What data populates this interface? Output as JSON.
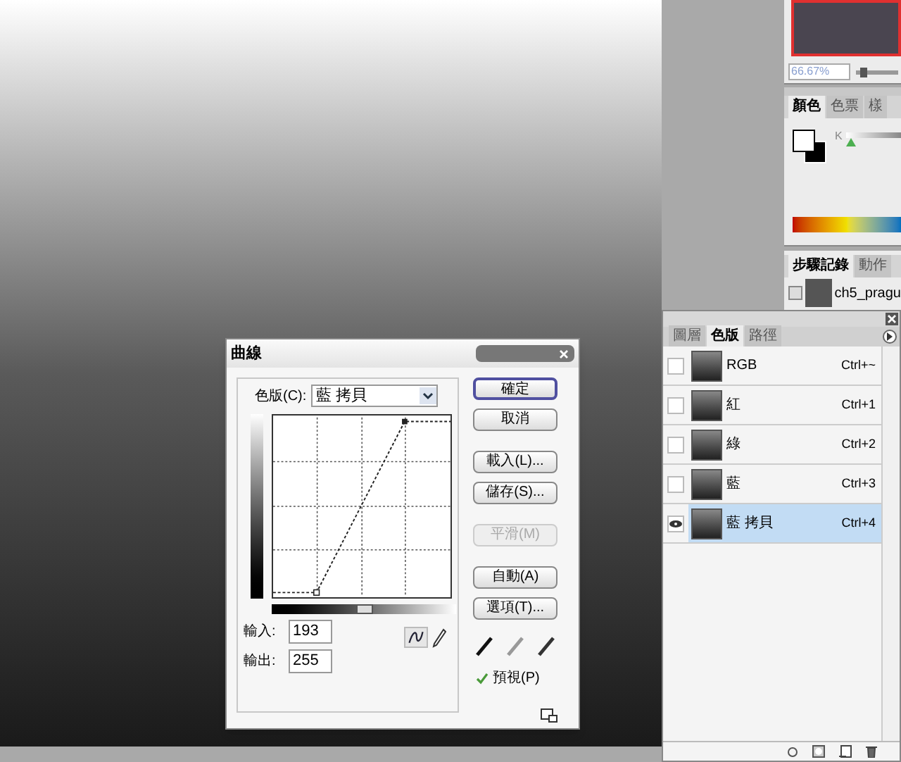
{
  "navigator": {
    "zoom": "66.67%",
    "level": 0.1
  },
  "color_panel": {
    "tabs": [
      {
        "label": "顏色",
        "selected": true
      },
      {
        "label": "色票",
        "selected": false
      },
      {
        "label": "樣",
        "selected": false
      }
    ],
    "slider_label": "K",
    "level": 0
  },
  "history_panel": {
    "tabs": [
      {
        "label": "步驟記錄",
        "selected": true
      },
      {
        "label": "動作",
        "selected": false
      }
    ],
    "items": [
      {
        "label": "ch5_pragu"
      }
    ]
  },
  "channels_panel": {
    "tabs": [
      {
        "label": "圖層",
        "selected": false
      },
      {
        "label": "色版",
        "selected": true
      },
      {
        "label": "路徑",
        "selected": false
      }
    ],
    "channels": [
      {
        "name": "RGB",
        "shortcut": "Ctrl+~",
        "visible": false,
        "selected": false
      },
      {
        "name": "紅",
        "shortcut": "Ctrl+1",
        "visible": false,
        "selected": false
      },
      {
        "name": "綠",
        "shortcut": "Ctrl+2",
        "visible": false,
        "selected": false
      },
      {
        "name": "藍",
        "shortcut": "Ctrl+3",
        "visible": false,
        "selected": false
      },
      {
        "name": "藍 拷貝",
        "shortcut": "Ctrl+4",
        "visible": true,
        "selected": true
      }
    ]
  },
  "curves_dialog": {
    "title": "曲線",
    "channel_label": "色版(C):",
    "channel": "藍 拷貝",
    "input_label": "輸入:",
    "input": "193",
    "output_label": "輸出:",
    "output": "255",
    "buttons": [
      {
        "label": "確定",
        "disabled": false,
        "default": true
      },
      {
        "label": "取消",
        "disabled": false,
        "default": false
      },
      {
        "label": "載入(L)...",
        "disabled": false,
        "default": false
      },
      {
        "label": "儲存(S)...",
        "disabled": false,
        "default": false
      },
      {
        "label": "平滑(M)",
        "disabled": true,
        "default": false
      },
      {
        "label": "自動(A)",
        "disabled": false,
        "default": false
      },
      {
        "label": "選項(T)...",
        "disabled": false,
        "default": false
      }
    ],
    "preview": {
      "label": "預視(P)",
      "checked": true
    }
  }
}
